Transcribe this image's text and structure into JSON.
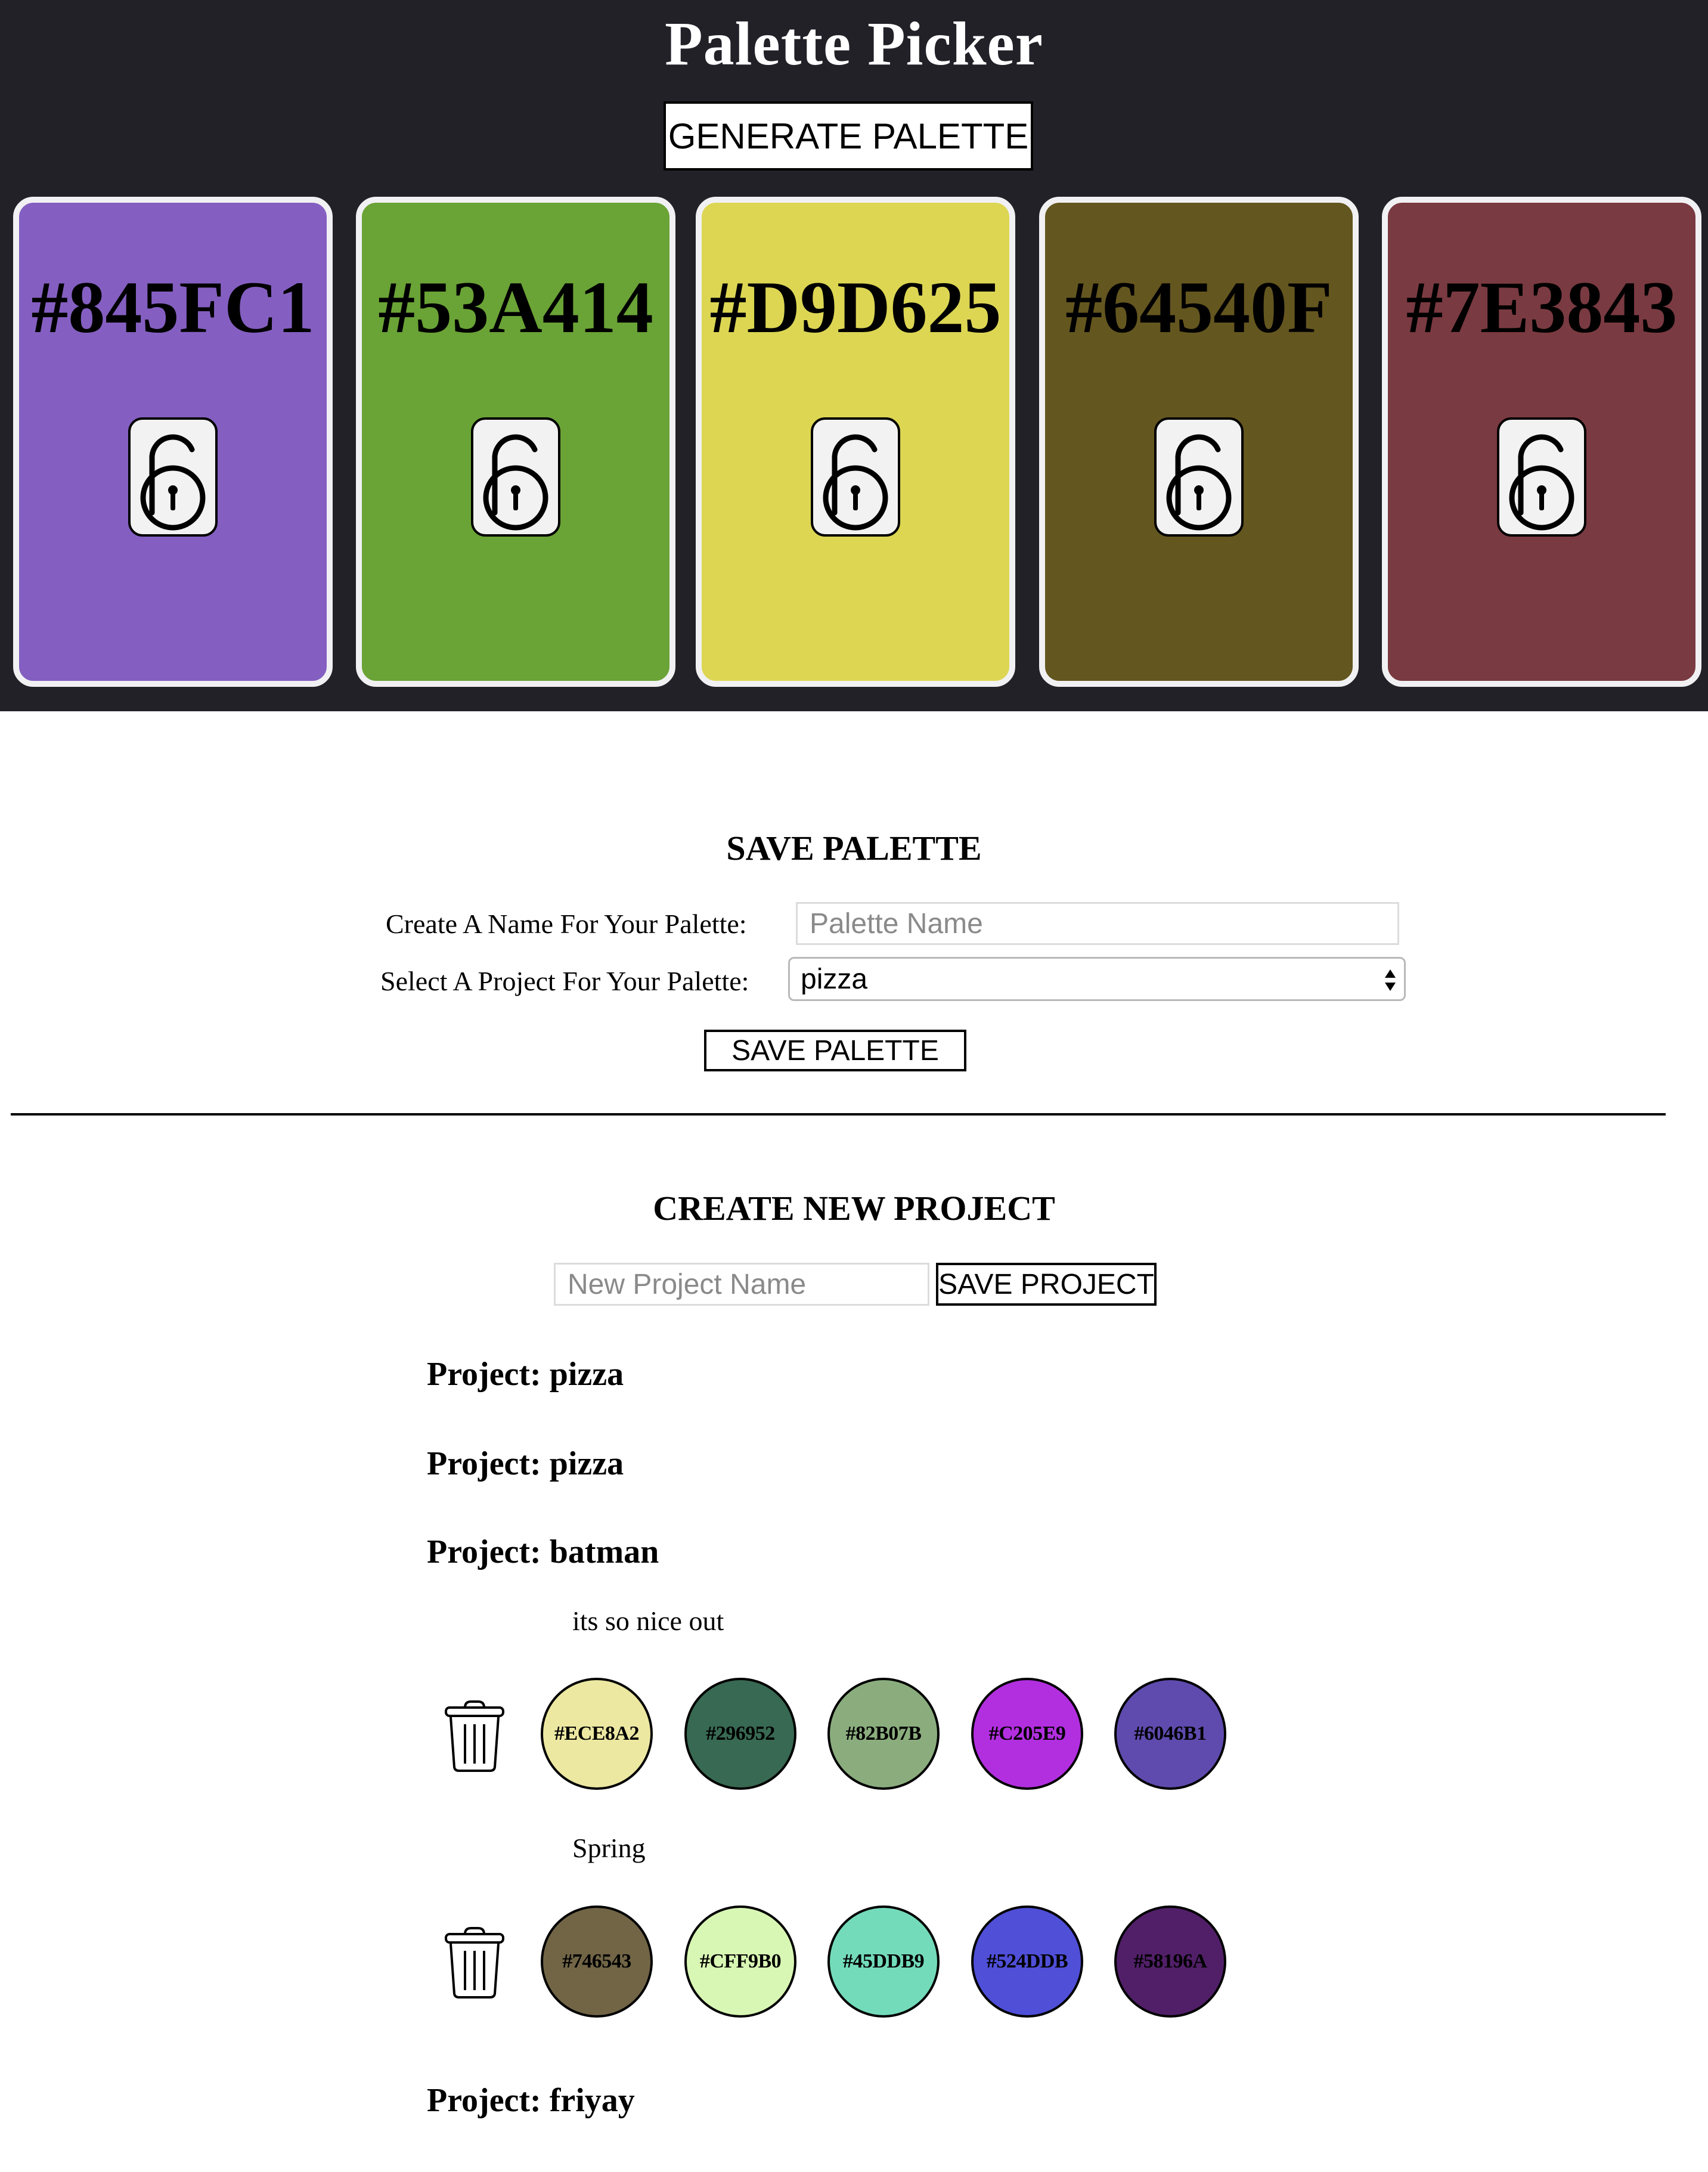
{
  "header": {
    "title": "Palette Picker",
    "generate_label": "GENERATE PALETTE",
    "background": "#222128"
  },
  "cards": [
    {
      "hex": "#845FC1",
      "color": "#845FC1",
      "icon": "unlocked-lock-icon"
    },
    {
      "hex": "#53A414",
      "color": "#6AA336",
      "icon": "unlocked-lock-icon"
    },
    {
      "hex": "#D9D625",
      "color": "#DCD653",
      "icon": "unlocked-lock-icon"
    },
    {
      "hex": "#64540F",
      "color": "#64561F",
      "icon": "unlocked-lock-icon"
    },
    {
      "hex": "#7E3843",
      "color": "#7A3A41",
      "icon": "unlocked-lock-icon"
    }
  ],
  "save_palette": {
    "heading": "SAVE PALETTE",
    "name_label": "Create A Name For Your Palette:",
    "name_value": "",
    "name_placeholder": "Palette Name",
    "project_label": "Select A Project For Your Palette:",
    "project_selected": "pizza",
    "save_label": "SAVE PALETTE"
  },
  "create_project": {
    "heading": "CREATE NEW PROJECT",
    "name_value": "",
    "name_placeholder": "New Project Name",
    "save_label": "SAVE PROJECT"
  },
  "projects": [
    {
      "title": "Project: pizza",
      "palettes": []
    },
    {
      "title": "Project: pizza",
      "palettes": []
    },
    {
      "title": "Project: batman",
      "palettes": [
        {
          "name": "its so nice out",
          "delete_icon": "trash-icon",
          "colors": [
            {
              "hex": "#ECE8A2",
              "color": "#ECE8A2"
            },
            {
              "hex": "#296952",
              "color": "#386952"
            },
            {
              "hex": "#82B07B",
              "color": "#8BAD7E"
            },
            {
              "hex": "#C205E9",
              "color": "#B22FE0"
            },
            {
              "hex": "#6046B1",
              "color": "#5F4BAE"
            }
          ]
        },
        {
          "name": "Spring",
          "delete_icon": "trash-icon",
          "colors": [
            {
              "hex": "#746543",
              "color": "#716546"
            },
            {
              "hex": "#CFF9B0",
              "color": "#D9F7B4"
            },
            {
              "hex": "#45DDB9",
              "color": "#74DBBA"
            },
            {
              "hex": "#524DDB",
              "color": "#4F4FD8"
            },
            {
              "hex": "#58196A",
              "color": "#511F68"
            }
          ]
        }
      ]
    },
    {
      "title": "Project: friyay",
      "palettes": []
    }
  ]
}
